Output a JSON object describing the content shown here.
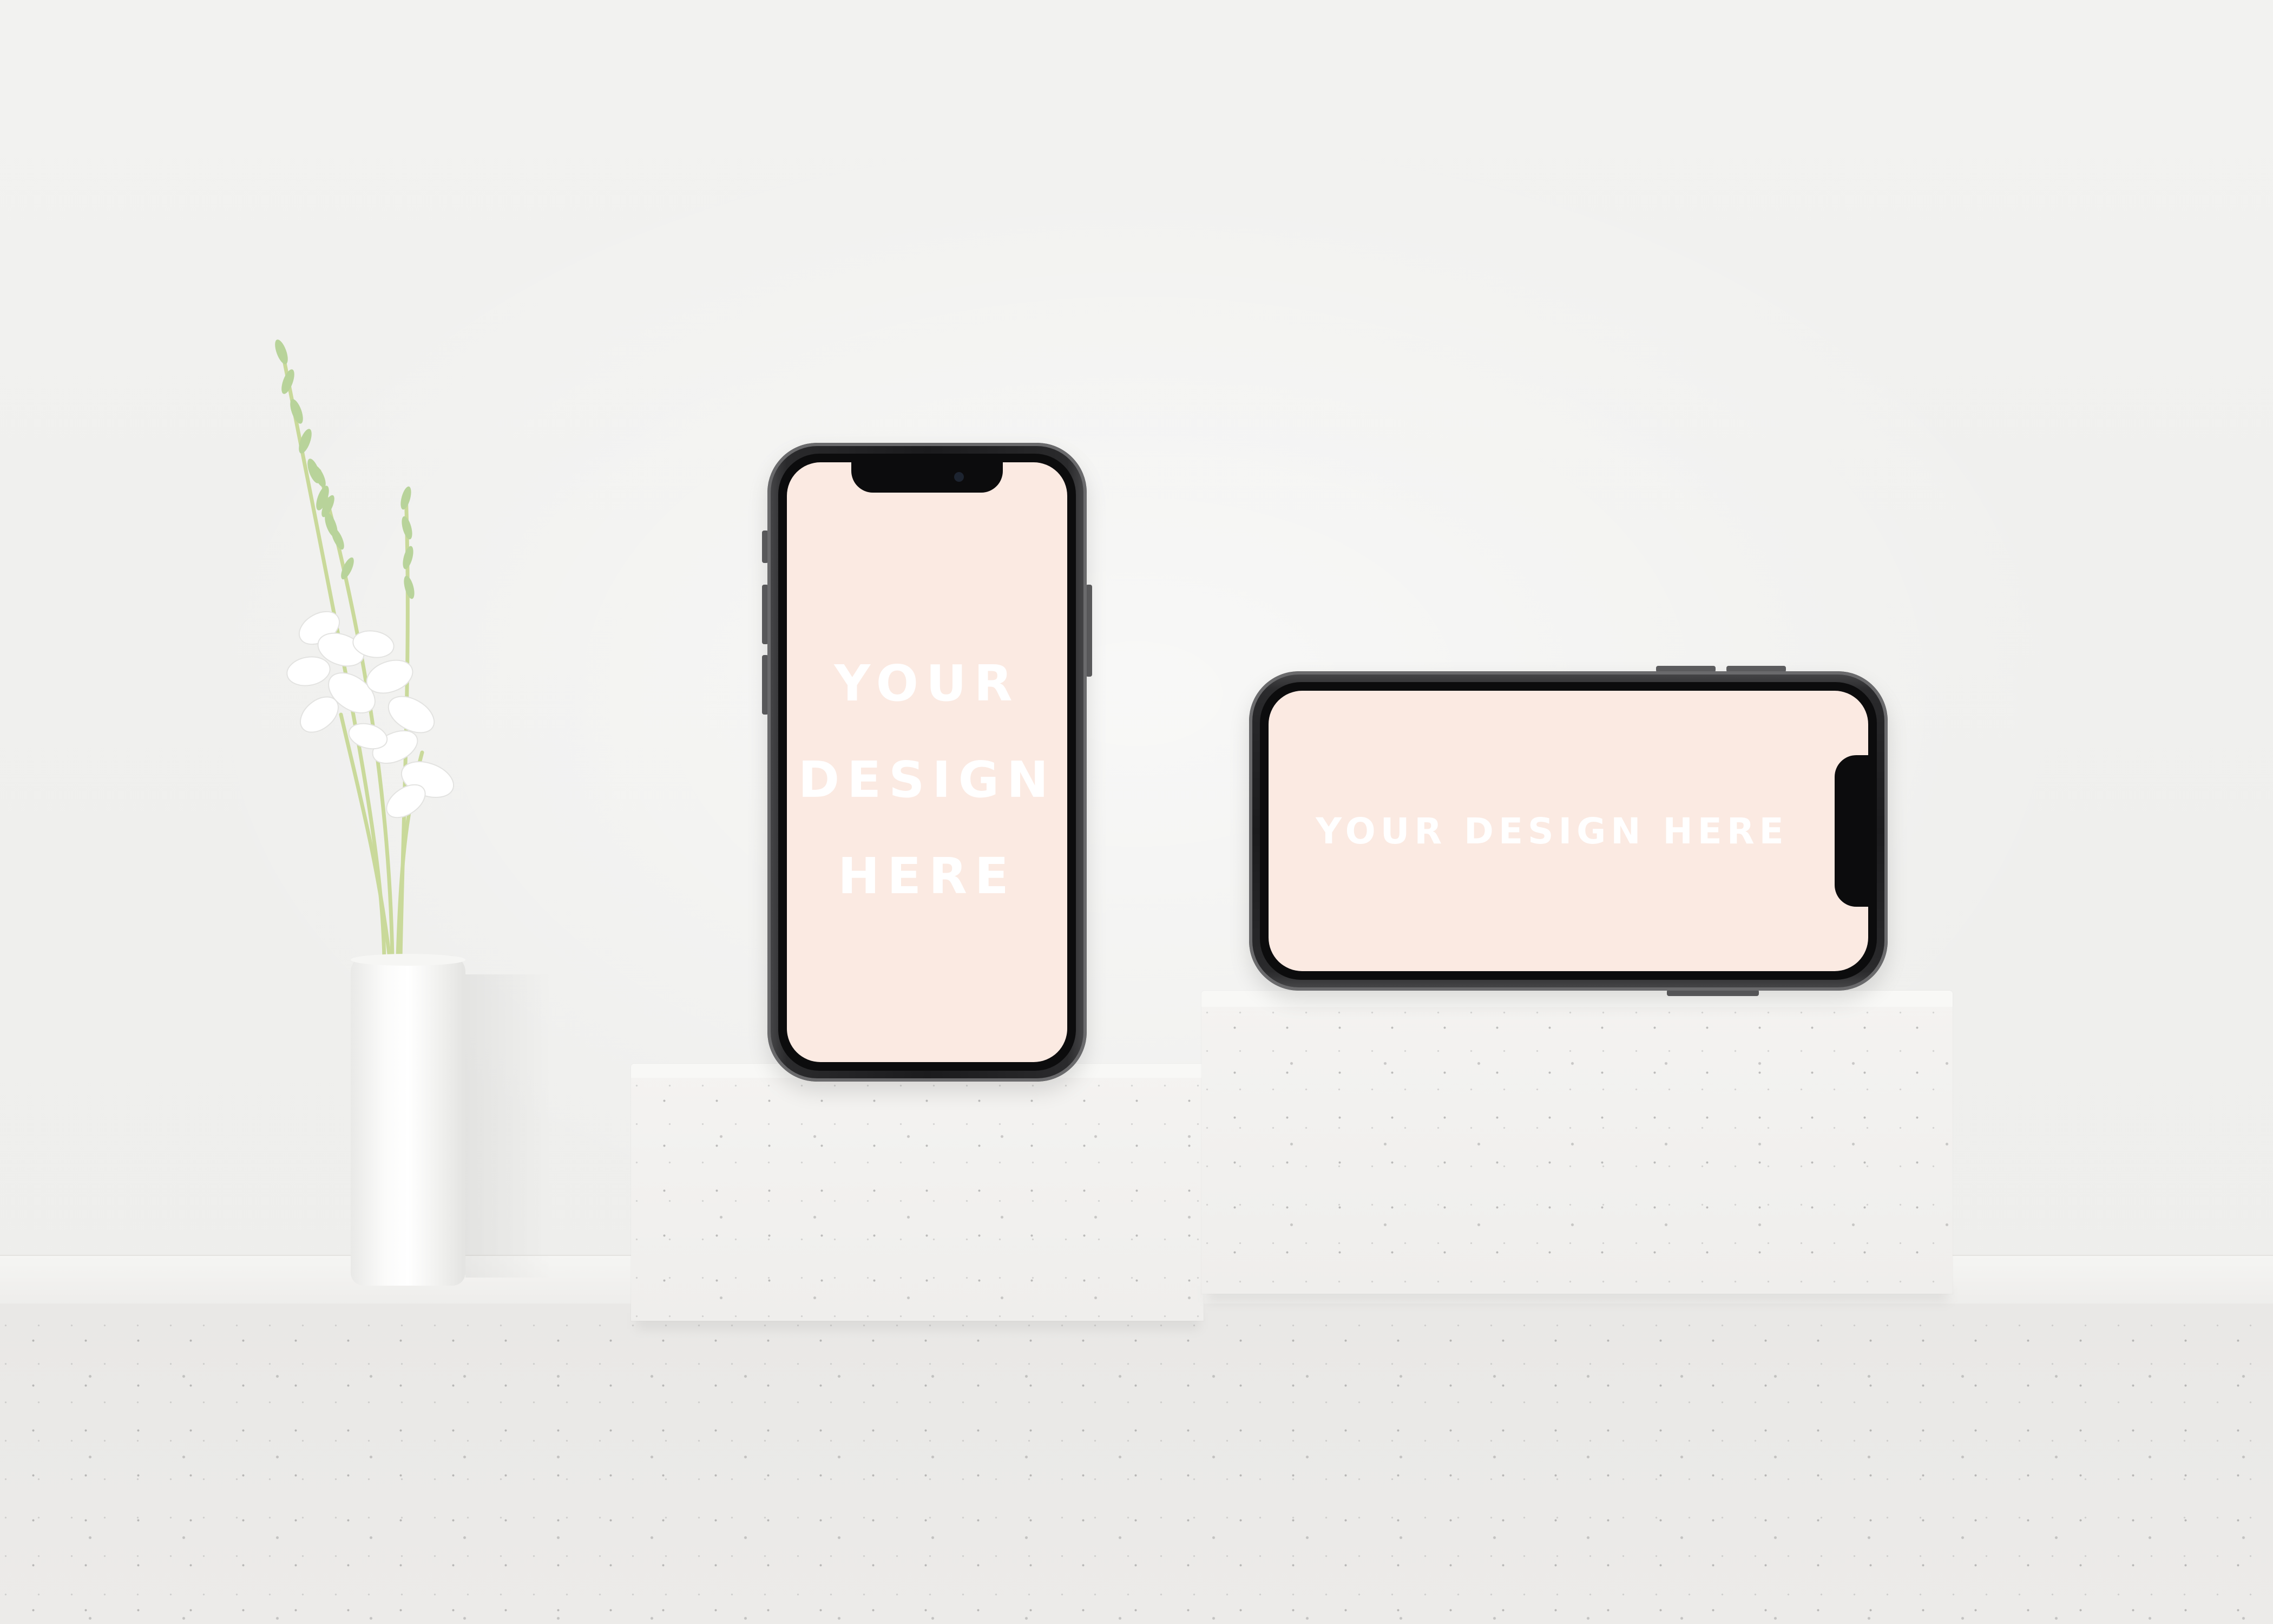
{
  "scene": {
    "background_color": "#f1f0ee",
    "screen_color": "#fbeae2",
    "text_color": "#ffffff"
  },
  "portrait_phone": {
    "lines": [
      "YOUR",
      "DESIGN",
      "HERE"
    ]
  },
  "landscape_phone": {
    "text": "YOUR DESIGN HERE"
  },
  "decor": {
    "vase": "white-vase",
    "plant": "white-flower-stems-icon"
  }
}
